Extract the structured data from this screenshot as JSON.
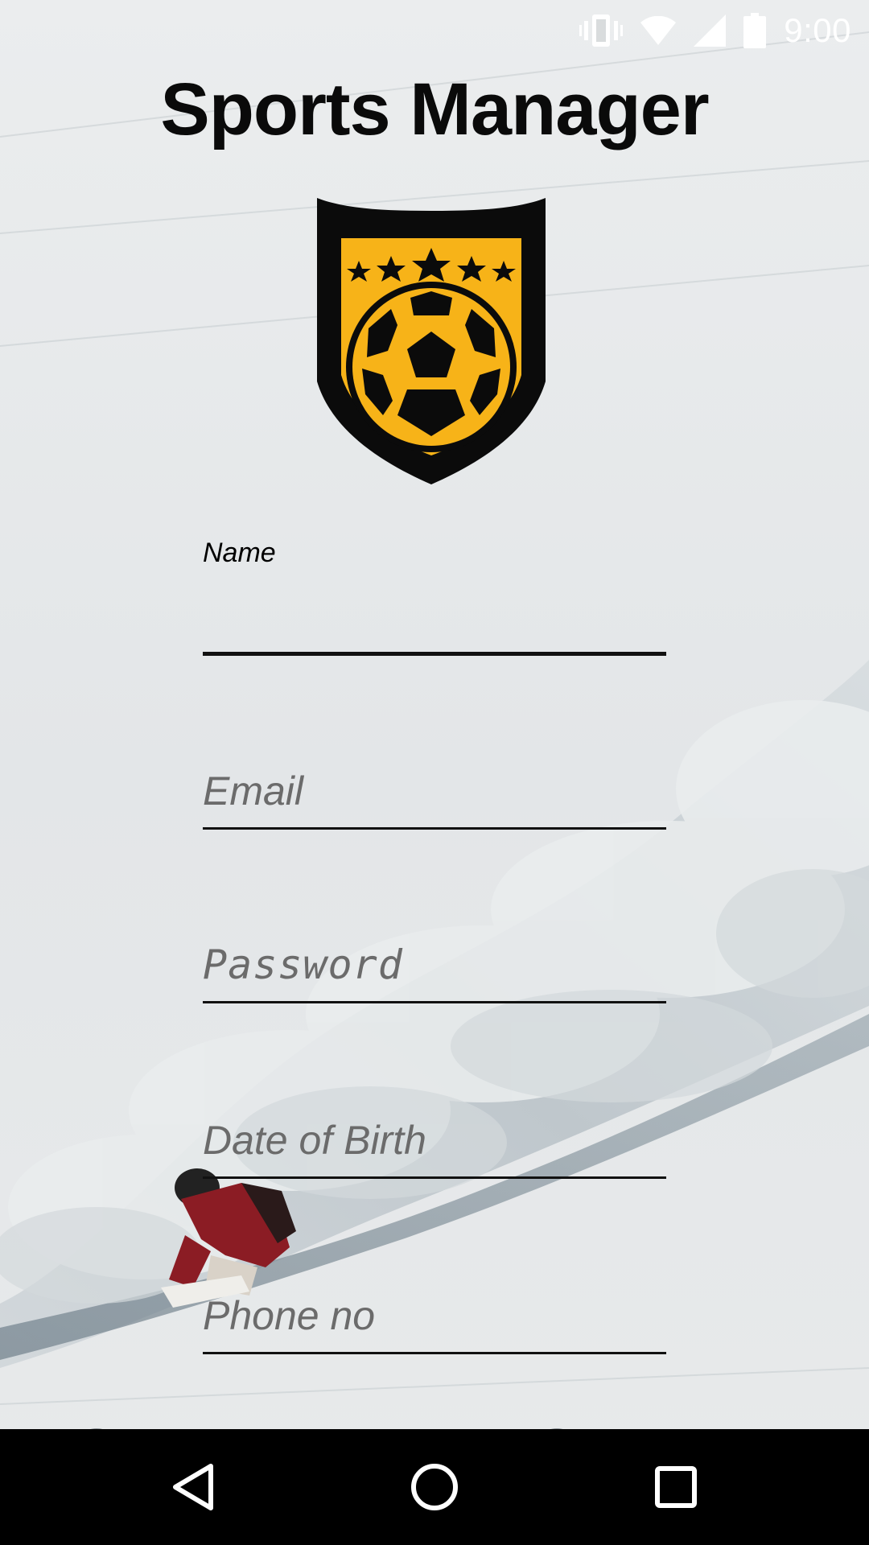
{
  "status_bar": {
    "time": "9:00",
    "icons": [
      "vibrate-icon",
      "wifi-icon",
      "cell-signal-icon",
      "battery-icon"
    ]
  },
  "app": {
    "title": "Sports Manager",
    "logo": "shield-soccer-ball-logo",
    "logo_colors": {
      "shield": "#0b0b0b",
      "field": "#f7b318"
    }
  },
  "form": {
    "name": {
      "label": "Name",
      "value": ""
    },
    "email": {
      "placeholder": "Email"
    },
    "password": {
      "placeholder": "Password"
    },
    "dob": {
      "placeholder": "Date of Birth"
    },
    "phone": {
      "placeholder": "Phone no"
    }
  },
  "nav_bar": {
    "buttons": [
      "back-icon",
      "home-icon",
      "recents-icon"
    ]
  }
}
